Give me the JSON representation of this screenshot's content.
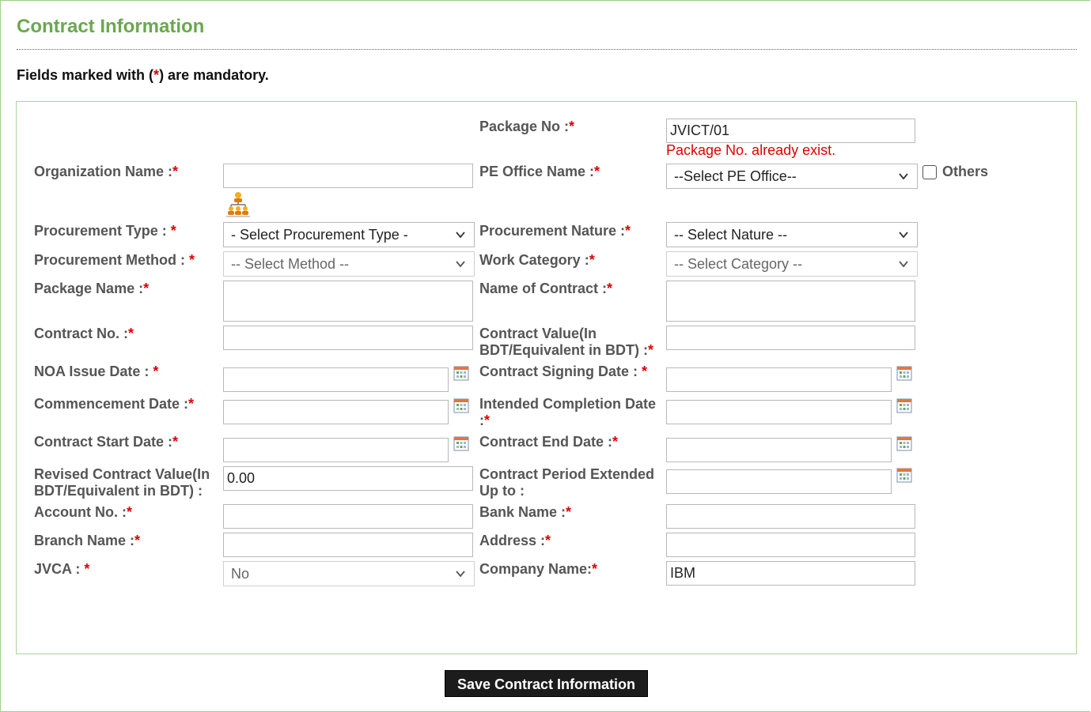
{
  "header": {
    "title": "Contract Information",
    "mandatory_prefix": "Fields marked with (",
    "mandatory_star": "*",
    "mandatory_suffix": ") are mandatory."
  },
  "form": {
    "package_no": {
      "label": "Package No :",
      "value": "JVICT/01",
      "error": "Package No. already exist."
    },
    "organization_name": {
      "label": "Organization Name :",
      "value": ""
    },
    "pe_office": {
      "label": "PE Office Name :",
      "selected": "--Select PE Office--",
      "others_label": "Others"
    },
    "procurement_type": {
      "label": "Procurement Type : ",
      "selected": "- Select Procurement Type -"
    },
    "procurement_nature": {
      "label": "Procurement Nature :",
      "selected": "-- Select Nature --"
    },
    "procurement_method": {
      "label": "Procurement Method : ",
      "selected": "-- Select Method --"
    },
    "work_category": {
      "label": "Work Category :",
      "selected": "-- Select Category --"
    },
    "package_name": {
      "label": "Package Name :",
      "value": ""
    },
    "name_of_contract": {
      "label": "Name of Contract :",
      "value": ""
    },
    "contract_no": {
      "label": "Contract No. :",
      "value": ""
    },
    "contract_value": {
      "label_line1": "Contract Value(In",
      "label_line2": "BDT/Equivalent in BDT) :",
      "value": ""
    },
    "noa_issue_date": {
      "label": "NOA Issue Date : ",
      "value": ""
    },
    "contract_signing_date": {
      "label": "Contract Signing Date : ",
      "value": ""
    },
    "commencement_date": {
      "label": "Commencement Date :",
      "value": ""
    },
    "intended_completion_date": {
      "label_line1": "Intended Completion Date",
      "label_line2": ":",
      "value": ""
    },
    "contract_start_date": {
      "label": "Contract Start Date :",
      "value": ""
    },
    "contract_end_date": {
      "label": "Contract End Date :",
      "value": ""
    },
    "revised_contract_value": {
      "label_line1": "Revised Contract Value(In",
      "label_line2": "BDT/Equivalent in BDT) :",
      "value": "0.00"
    },
    "contract_period_extended": {
      "label_line1": "Contract Period Extended",
      "label_line2": "Up to :",
      "value": ""
    },
    "account_no": {
      "label": "Account No. :",
      "value": ""
    },
    "bank_name": {
      "label": "Bank Name :",
      "value": ""
    },
    "branch_name": {
      "label": "Branch Name :",
      "value": ""
    },
    "address": {
      "label": "Address :",
      "value": ""
    },
    "jvca": {
      "label": "JVCA : ",
      "selected": "No"
    },
    "company_name": {
      "label": "Company Name:",
      "value": "IBM"
    },
    "required_mark": "*"
  },
  "actions": {
    "save_label": "Save Contract Information"
  },
  "colors": {
    "title": "#6aa84f",
    "required": "#e00000",
    "button_bg": "#1c1c1c"
  },
  "icons": {
    "calendar": "calendar-icon",
    "dropdown": "chevron-down-icon",
    "org_tree": "org-tree-icon"
  }
}
